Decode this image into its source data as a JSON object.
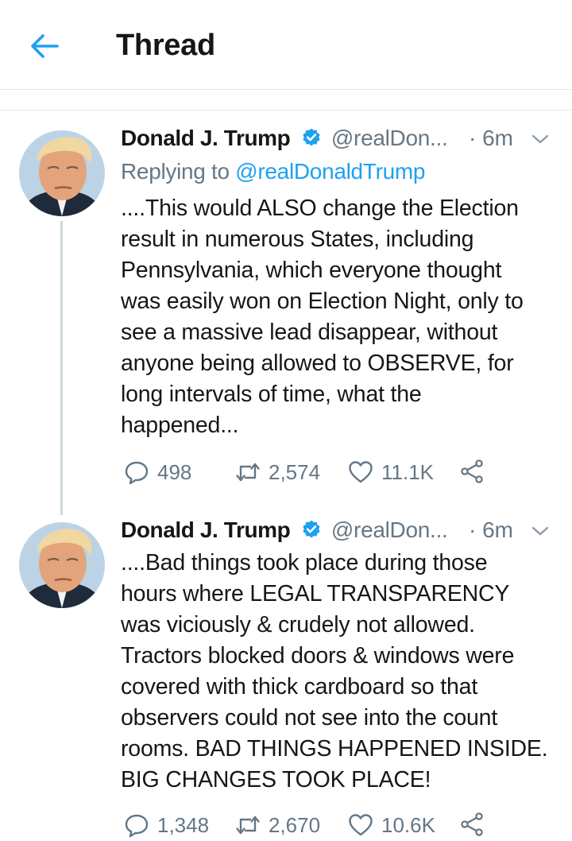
{
  "header": {
    "title": "Thread"
  },
  "tweets": [
    {
      "name": "Donald J. Trump",
      "handle": "@realDon...",
      "time": "· 6m",
      "reply_prefix": "Replying to ",
      "reply_handle": "@realDonaldTrump",
      "text": "....This would ALSO change the Election\nresult in numerous States, including\nPennsylvania, which everyone thought\nwas easily won on Election Night, only to\nsee a massive lead disappear, without\nanyone being allowed to OBSERVE, for\nlong intervals of time, what the\nhappened...",
      "replies": "498",
      "retweets": "2,574",
      "likes": "11.1K"
    },
    {
      "name": "Donald J. Trump",
      "handle": "@realDon...",
      "time": "· 6m",
      "text": "....Bad things took place during those\nhours where LEGAL TRANSPARENCY\nwas viciously & crudely not allowed.\nTractors blocked doors & windows were\ncovered with thick cardboard so that\nobservers could not see into the count\nrooms. BAD THINGS HAPPENED INSIDE.\nBIG CHANGES TOOK PLACE!",
      "replies": "1,348",
      "retweets": "2,670",
      "likes": "10.6K"
    }
  ],
  "icons": {
    "back": "back-arrow-icon",
    "verified": "verified-badge-icon",
    "caret": "chevron-down-icon",
    "reply": "reply-icon",
    "retweet": "retweet-icon",
    "like": "heart-icon",
    "share": "share-icon"
  },
  "colors": {
    "accent": "#1da1f2",
    "text": "#14171a",
    "muted": "#657786",
    "divider": "#e1e8ed",
    "thread_line": "#ccd6dd"
  }
}
